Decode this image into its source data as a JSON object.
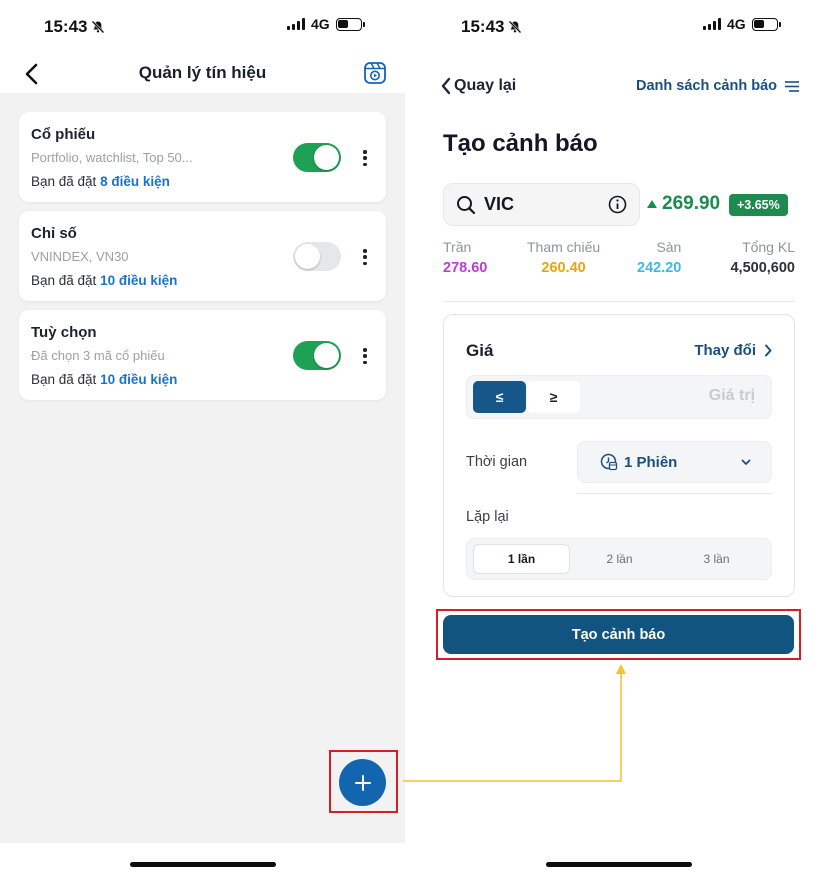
{
  "status": {
    "time": "15:43",
    "network": "4G"
  },
  "left": {
    "title": "Quản lý tín hiệu",
    "cards": [
      {
        "title": "Cổ phiếu",
        "subtitle": "Portfolio, watchlist, Top 50...",
        "prefix": "Bạn đã đặt",
        "conditions": "8 điều kiện",
        "enabled": true
      },
      {
        "title": "Chỉ số",
        "subtitle": "VNINDEX, VN30",
        "prefix": "Bạn đã đặt",
        "conditions": "10 điều kiện",
        "enabled": false
      },
      {
        "title": "Tuỳ chọn",
        "subtitle": "Đã chọn 3 mã cổ phiếu",
        "prefix": "Bạn đã đặt",
        "conditions": "10 điều kiện",
        "enabled": true
      }
    ],
    "fab_label": "+"
  },
  "right": {
    "back_label": "Quay lại",
    "alert_list_label": "Danh sách cảnh báo",
    "page_title": "Tạo cảnh báo",
    "symbol": "VIC",
    "price": "269.90",
    "change_pct": "+3.65%",
    "stats": [
      {
        "label": "Trần",
        "value": "278.60",
        "color": "#c03ad6"
      },
      {
        "label": "Tham chiếu",
        "value": "260.40",
        "color": "#e8a417"
      },
      {
        "label": "Sàn",
        "value": "242.20",
        "color": "#3fb8e6"
      },
      {
        "label": "Tổng KL",
        "value": "4,500,600",
        "color": "#2c313b"
      }
    ],
    "form": {
      "field_label": "Giá",
      "change_label": "Thay đổi",
      "lte_label": "≤",
      "gte_label": "≥",
      "value_placeholder": "Giá trị",
      "time_label": "Thời gian",
      "session_value": "1 Phiên",
      "repeat_label": "Lặp lại",
      "repeat_options": [
        "1 lần",
        "2 lần",
        "3 lần"
      ],
      "repeat_selected": 0
    },
    "submit_label": "Tạo cảnh báo"
  },
  "colors": {
    "primary": "#10547f",
    "link": "#1a73c9",
    "toggle_on": "#1fa155",
    "up": "#1c8b4f",
    "highlight": "#d41f26",
    "connector": "#f2c230"
  }
}
